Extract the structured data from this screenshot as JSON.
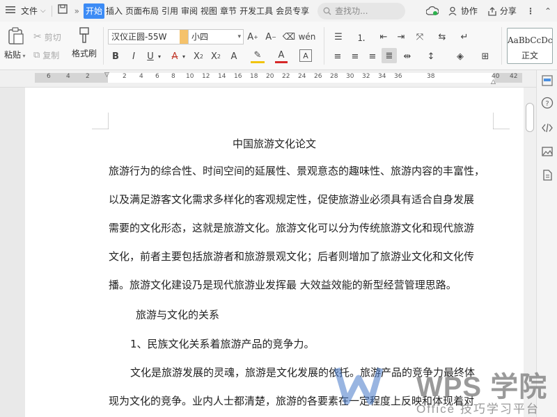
{
  "menubar": {
    "file_label": "文件",
    "tabs": [
      "开始",
      "插入",
      "页面布局",
      "引用",
      "审阅",
      "视图",
      "章节",
      "开发工具",
      "会员专享"
    ],
    "search_placeholder": "查找功...",
    "collab_label": "协作",
    "share_label": "分享"
  },
  "ribbon": {
    "paste_label": "粘贴",
    "cut_label": "剪切",
    "copy_label": "复制",
    "format_painter_label": "格式刷",
    "font_name": "汉仪正圆-55W",
    "font_size": "小四",
    "style_preview": "AaBbCcDc",
    "style_name": "正文"
  },
  "ruler": {
    "ticks": [
      "6",
      "4",
      "2",
      "2",
      "4",
      "6",
      "8",
      "10",
      "12",
      "14",
      "16",
      "18",
      "20",
      "22",
      "24",
      "26",
      "28",
      "30",
      "32",
      "34",
      "36",
      "38",
      "40",
      "42"
    ]
  },
  "document": {
    "title": "中国旅游文化论文",
    "lines": [
      "旅游行为的综合性、时间空间的延展性、景观意态的趣味性、旅游内容的丰富性，",
      "以及满足游客文化需求多样化的客观规定性，促使旅游业必须具有适合自身发展",
      "需要的文化形态，这就是旅游文化。旅游文化可以分为传统旅游文化和现代旅游",
      "文化，前者主要包括旅游者和旅游景观文化；后者则增加了旅游业文化和文化传",
      "播。旅游文化建设乃是现代旅游业发挥最  大效益效能的新型经营管理思路。",
      "旅游与文化的关系",
      "1、民族文化关系着旅游产品的竞争力。",
      "文化是旅游发展的灵魂，旅游是文化发展的依托。旅游产品的竞争力最终体",
      "现为文化的竞争。业内人士都清楚，旅游的各要素在一定程度上反映和体现着对"
    ]
  },
  "watermark": {
    "brand": "WPS 学院",
    "tagline": "Office 技巧学习平台"
  }
}
